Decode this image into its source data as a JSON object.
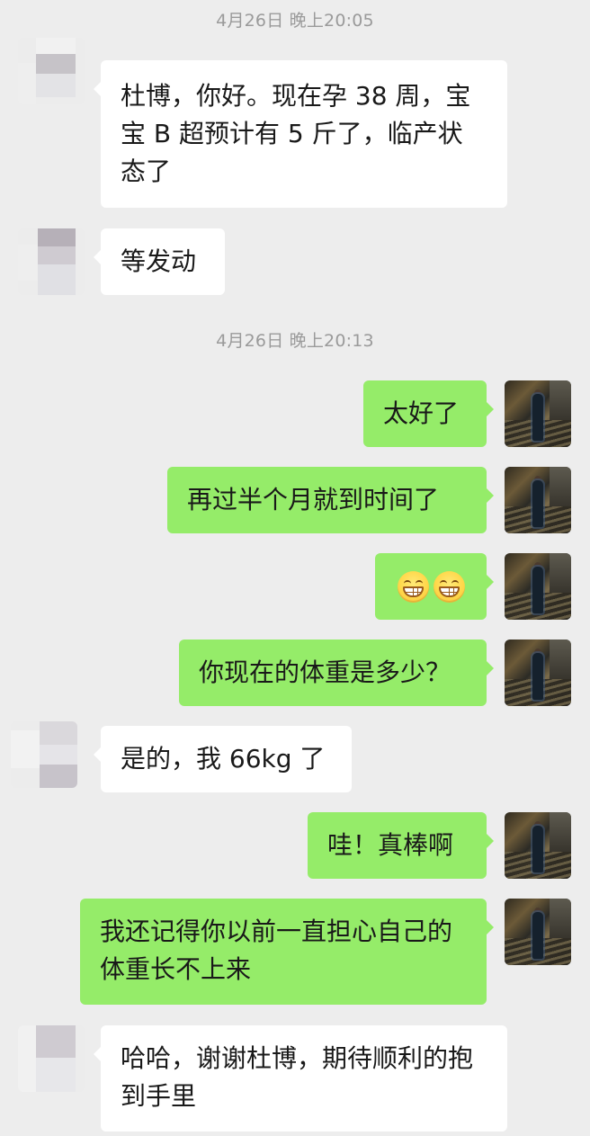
{
  "chat": {
    "timestamps": [
      "4月26日 晚上20:05",
      "4月26日 晚上20:13"
    ],
    "messages": [
      {
        "sender": "other",
        "text": "杜博，你好。现在孕 38 周，宝宝 B 超预计有 5 斤了，临产状态了"
      },
      {
        "sender": "other",
        "text": "等发动"
      },
      {
        "sender": "self",
        "text": "太好了"
      },
      {
        "sender": "self",
        "text": "再过半个月就到时间了"
      },
      {
        "sender": "self",
        "emoji": [
          "grinning-face",
          "grinning-face"
        ]
      },
      {
        "sender": "self",
        "text": "你现在的体重是多少？"
      },
      {
        "sender": "other",
        "text": "是的，我 66kg 了"
      },
      {
        "sender": "self",
        "text": "哇！真棒啊"
      },
      {
        "sender": "self",
        "text": "我还记得你以前一直担心自己的体重长不上来"
      },
      {
        "sender": "other",
        "text": "哈哈，谢谢杜博，期待顺利的抱到手里"
      }
    ]
  },
  "colors": {
    "background": "#ededed",
    "bubble_self": "#95ec69",
    "bubble_other": "#ffffff",
    "timestamp": "#9a9a9a"
  }
}
